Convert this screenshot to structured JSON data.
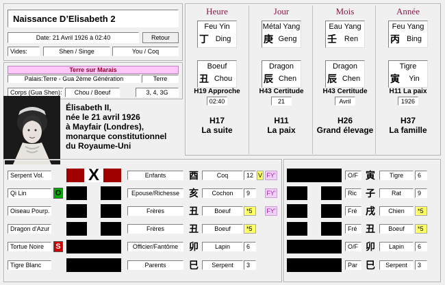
{
  "title": "Naissance D’Elisabeth 2",
  "date_label": "Date: 21 Avril 1926 à 02:40",
  "retour_label": "Retour",
  "vides_label": "Vides:",
  "vides_a": "Shen / Singe",
  "vides_b": "You / Coq",
  "marais_label": "Terre sur Marais",
  "palais_label": "Palais:Terre -  Gua 2ème Génération",
  "palais_value": "Terre",
  "corps_label": "Corps (Gua Shen):",
  "corps_value": "Chou / Boeuf",
  "corps_nums": "3, 4, 3G",
  "bio_text": "Élisabeth II,\nnée le 21 avril 1926\nà Mayfair (Londres),\nmonarque constitutionnel\ndu Royaume-Uni",
  "pillars": [
    {
      "title": "Heure",
      "stem_name": "Feu Yin",
      "stem_char": "丁",
      "stem_py": "Ding",
      "branch_name": "Boeuf",
      "branch_char": "丑",
      "branch_py": "Chou",
      "hex_a": "H19 Approche",
      "value": "02:40",
      "hex_b": "H17",
      "hex_b_name": "La suite"
    },
    {
      "title": "Jour",
      "stem_name": "Métal Yang",
      "stem_char": "庚",
      "stem_py": "Geng",
      "branch_name": "Dragon",
      "branch_char": "辰",
      "branch_py": "Chen",
      "hex_a": "H43 Certitude",
      "value": "21",
      "hex_b": "H11",
      "hex_b_name": "La paix"
    },
    {
      "title": "Mois",
      "stem_name": "Eau Yang",
      "stem_char": "壬",
      "stem_py": "Ren",
      "branch_name": "Dragon",
      "branch_char": "辰",
      "branch_py": "Chen",
      "hex_a": "H43 Certitude",
      "value": "Avril",
      "hex_b": "H26",
      "hex_b_name": "Grand élevage"
    },
    {
      "title": "Année",
      "stem_name": "Feu Yang",
      "stem_char": "丙",
      "stem_py": "Bing",
      "branch_name": "Tigre",
      "branch_char": "寅",
      "branch_py": "Yin",
      "hex_a": "H11 La paix",
      "value": "1926",
      "hex_b": "H37",
      "hex_b_name": "La famille"
    }
  ],
  "left_rows": [
    {
      "animal": "Serpent Vol.",
      "badge": "",
      "bar": "moving",
      "relation": "Enfants",
      "char": "酉",
      "branch": "Coq",
      "num": "12",
      "v": "V",
      "fy": "FY'",
      "mark": ""
    },
    {
      "animal": "Qi Lin",
      "badge": "O",
      "bar": "yin",
      "relation": "Epouse/Richesse",
      "char": "亥",
      "branch": "Cochon",
      "num": "9",
      "v": "",
      "fy": "FY'",
      "mark": ""
    },
    {
      "animal": "Oiseau Pourp.",
      "badge": "",
      "bar": "yin",
      "relation": "Frères",
      "char": "丑",
      "branch": "Boeuf",
      "num": "",
      "v": "",
      "fy": "FY'",
      "mark": "*5"
    },
    {
      "animal": "Dragon d'Azur",
      "badge": "",
      "bar": "yin",
      "relation": "Frères",
      "char": "丑",
      "branch": "Boeuf",
      "num": "",
      "v": "",
      "fy": "",
      "mark": "*5"
    },
    {
      "animal": "Tortue Noire",
      "badge": "S",
      "bar": "yang",
      "relation": "Officier/Fantôme",
      "char": "卯",
      "branch": "Lapin",
      "num": "6",
      "v": "",
      "fy": "",
      "mark": ""
    },
    {
      "animal": "Tigre Blanc",
      "badge": "",
      "bar": "yang",
      "relation": "Parents",
      "char": "巳",
      "branch": "Serpent",
      "num": "3",
      "v": "",
      "fy": "",
      "mark": ""
    }
  ],
  "moving_mark": "X",
  "right_rows": [
    {
      "bar": "yang",
      "rel": "O/F",
      "char": "寅",
      "branch": "Tigre",
      "num": "6",
      "mark": ""
    },
    {
      "bar": "yin",
      "rel": "Ric",
      "char": "子",
      "branch": "Rat",
      "num": "9",
      "mark": ""
    },
    {
      "bar": "yin",
      "rel": "Fré",
      "char": "戌",
      "branch": "Chien",
      "num": "",
      "mark": "*5"
    },
    {
      "bar": "yin",
      "rel": "Fré",
      "char": "丑",
      "branch": "Boeuf",
      "num": "",
      "mark": "*5"
    },
    {
      "bar": "yang",
      "rel": "O/F",
      "char": "卯",
      "branch": "Lapin",
      "num": "6",
      "mark": ""
    },
    {
      "bar": "yang",
      "rel": "Par",
      "char": "巳",
      "branch": "Serpent",
      "num": "3",
      "mark": ""
    }
  ],
  "colors": {
    "title_magenta": "#8b1a4a",
    "marais_bg": "#ffc8f8",
    "moving_red": "#a00000",
    "yellow": "#ffff66"
  }
}
